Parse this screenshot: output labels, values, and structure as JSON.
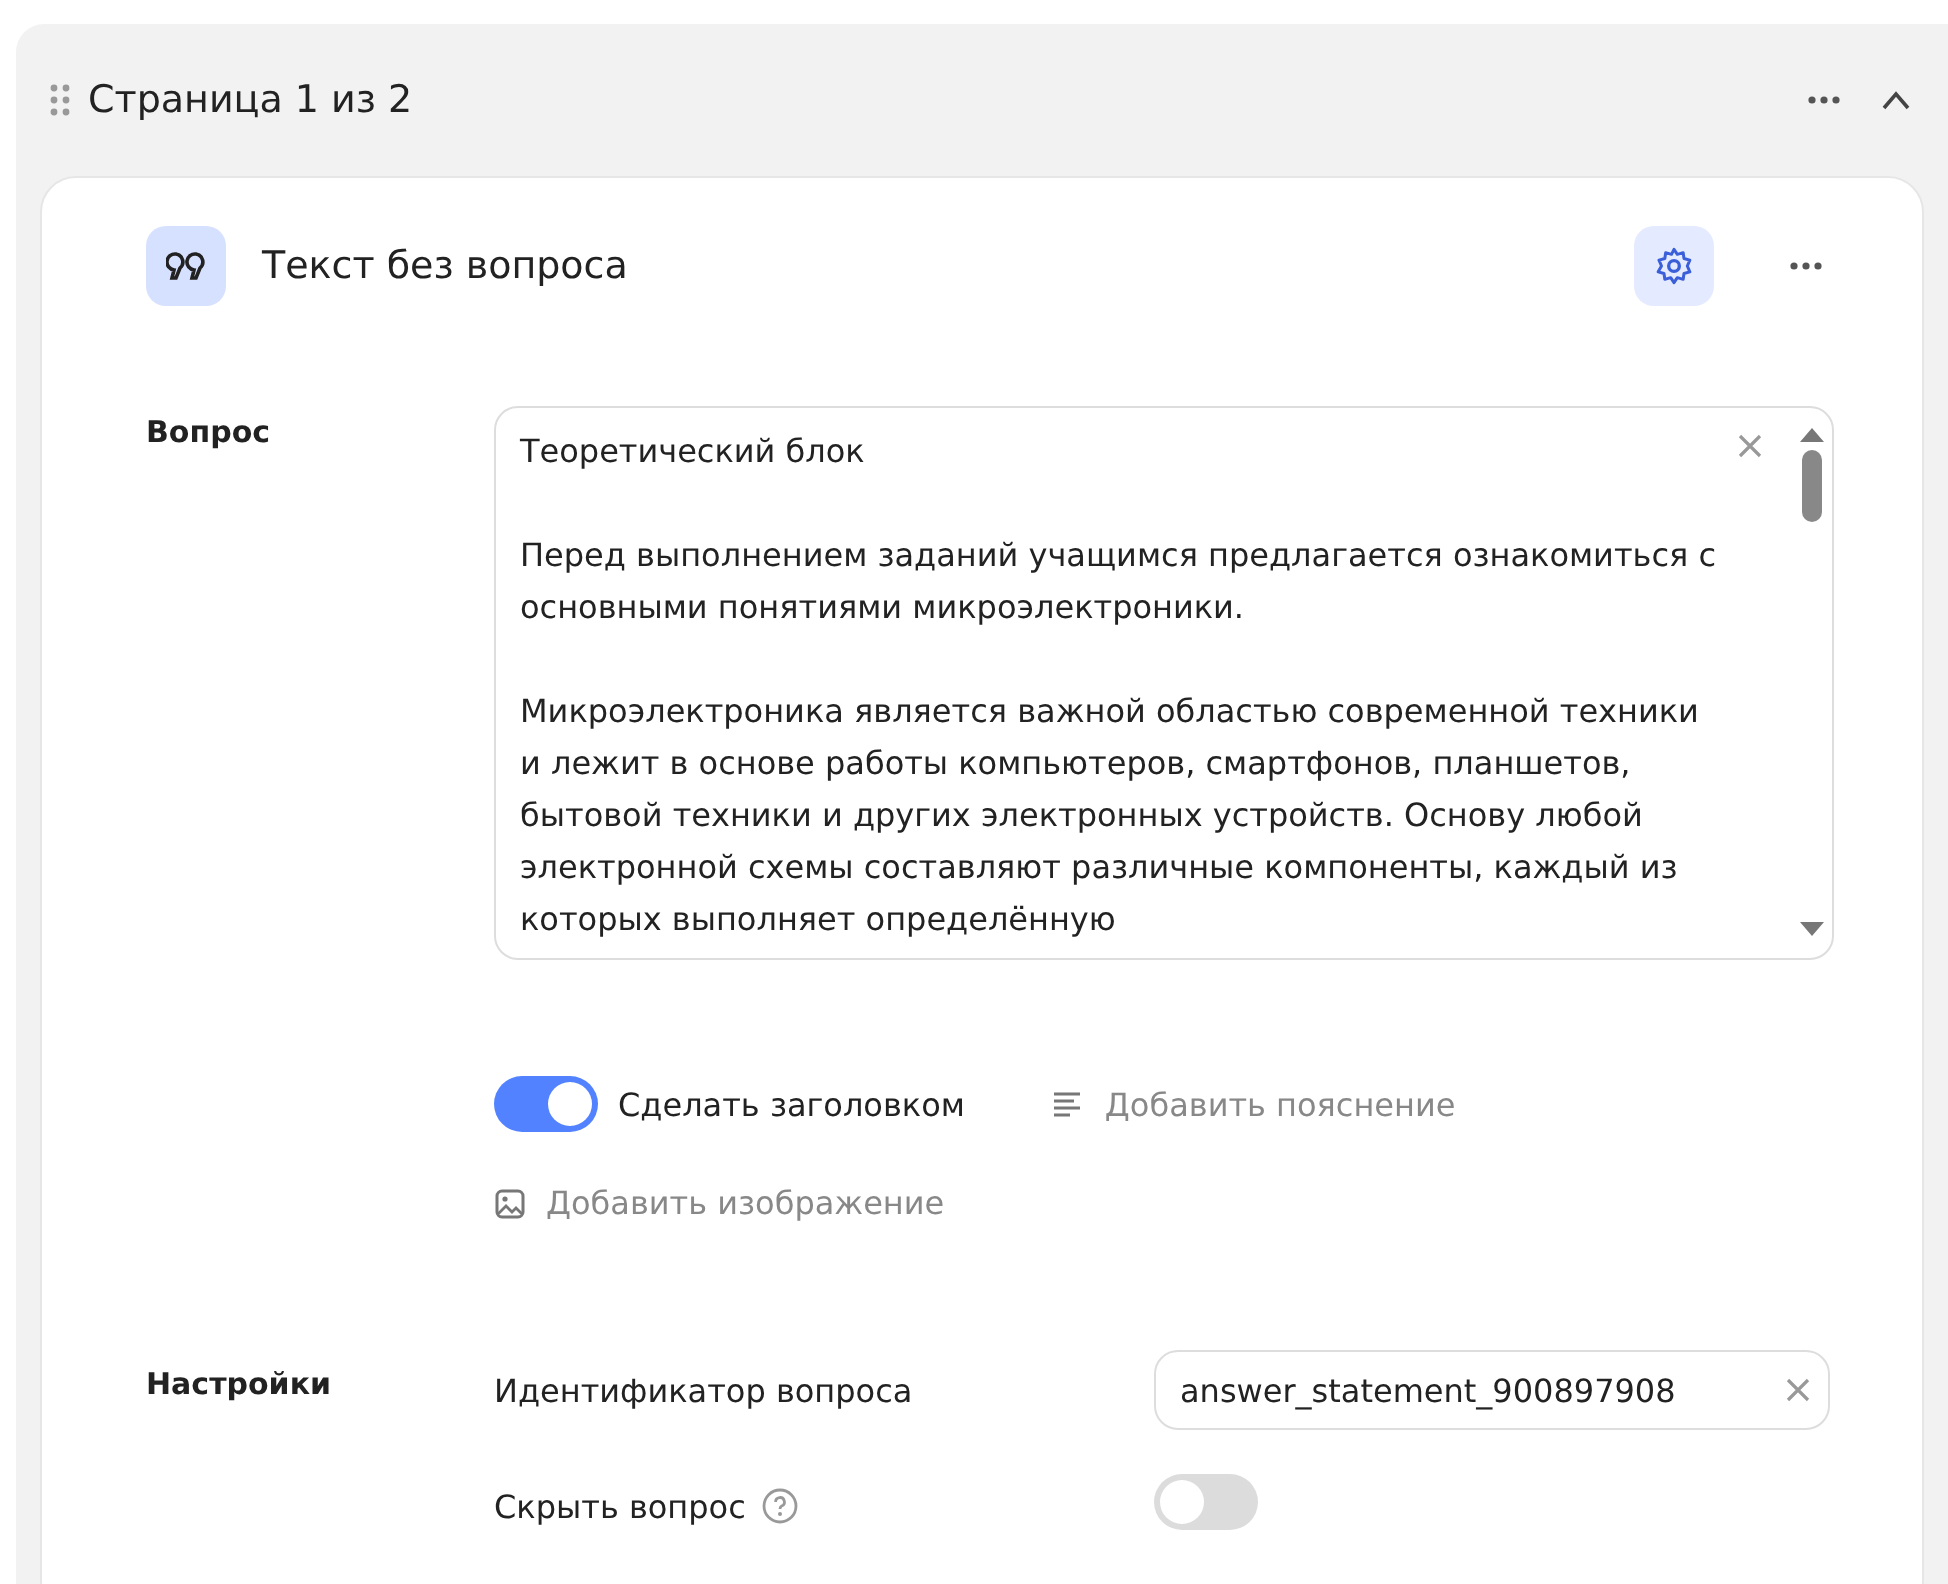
{
  "page_header": {
    "title": "Страница 1 из 2",
    "expanded": true
  },
  "question_card": {
    "type_title": "Текст без вопроса",
    "question_label": "Вопрос",
    "question_text": [
      "Теоретический блок",
      "Перед выполнением заданий учащимся предлагается ознакомиться с основными понятиями микроэлектроники.",
      "Микроэлектроника является важной областью современной техники и лежит в основе работы компьютеров, смартфонов, планшетов, бытовой техники и других электронных устройств. Основу любой электронной схемы составляют различные компоненты, каждый из которых выполняет определённую"
    ],
    "make_heading": {
      "label": "Сделать заголовком",
      "on": true
    },
    "add_hint": "Добавить пояснение",
    "add_image": "Добавить изображение",
    "settings_label": "Настройки",
    "id_label": "Идентификатор вопроса",
    "id_value": "answer_statement_900897908",
    "hide": {
      "label": "Скрыть вопрос",
      "on": false
    }
  }
}
